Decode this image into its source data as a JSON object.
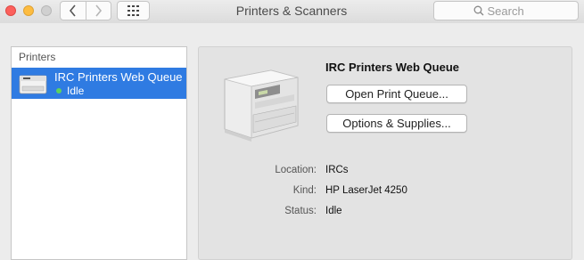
{
  "window": {
    "title": "Printers & Scanners",
    "search_placeholder": "Search"
  },
  "sidebar": {
    "header": "Printers",
    "items": [
      {
        "name": "IRC Printers Web Queue",
        "status": "Idle",
        "status_color": "#5ed25e",
        "selected": true
      }
    ]
  },
  "detail": {
    "printer_name": "IRC Printers Web Queue",
    "open_queue_label": "Open Print Queue...",
    "options_label": "Options & Supplies...",
    "info": [
      {
        "label": "Location:",
        "value": "IRCs"
      },
      {
        "label": "Kind:",
        "value": "HP LaserJet 4250"
      },
      {
        "label": "Status:",
        "value": "Idle"
      }
    ]
  },
  "colors": {
    "selection": "#2f7be2",
    "close": "#fc605c",
    "minimize": "#fdbc40",
    "zoom_disabled": "#d0d0d0"
  }
}
